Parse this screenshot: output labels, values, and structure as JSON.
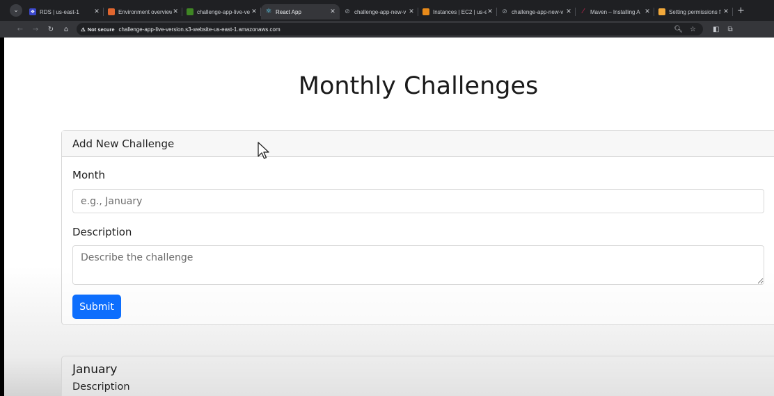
{
  "browser": {
    "tabs": [
      {
        "label": "RDS | us-east-1",
        "favicon_color": "#3b48cc",
        "favicon_glyph": "❖",
        "active": false
      },
      {
        "label": "Environment overview",
        "favicon_color": "#e0662f",
        "favicon_glyph": "▣",
        "active": false
      },
      {
        "label": "challenge-app-live-ve",
        "favicon_color": "#3f8624",
        "favicon_glyph": "▣",
        "active": false
      },
      {
        "label": "React App",
        "favicon_color": "#61dafb",
        "favicon_glyph": "⚛",
        "active": true
      },
      {
        "label": "challenge-app-new-v",
        "favicon_color": "#5f6368",
        "favicon_glyph": "⊘",
        "active": false
      },
      {
        "label": "Instances | EC2 | us-e",
        "favicon_color": "#e88a1a",
        "favicon_glyph": "▣",
        "active": false
      },
      {
        "label": "challenge-app-new-v",
        "favicon_color": "#5f6368",
        "favicon_glyph": "⊘",
        "active": false
      },
      {
        "label": "Maven – Installing A",
        "favicon_color": "#c7254e",
        "favicon_glyph": "⁄",
        "active": false
      },
      {
        "label": "Setting permissions f",
        "favicon_color": "#f2a93b",
        "favicon_glyph": "◆",
        "active": false
      }
    ],
    "security_label": "Not secure",
    "url": "challenge-app-live-version.s3-website-us-east-1.amazonaws.com"
  },
  "page": {
    "title": "Monthly Challenges",
    "form": {
      "header": "Add New Challenge",
      "month_label": "Month",
      "month_placeholder": "e.g., January",
      "description_label": "Description",
      "description_placeholder": "Describe the challenge",
      "submit_label": "Submit",
      "submit_color": "#0d6efd"
    },
    "challenges": [
      {
        "month": "January",
        "description_label": "Description"
      }
    ]
  }
}
